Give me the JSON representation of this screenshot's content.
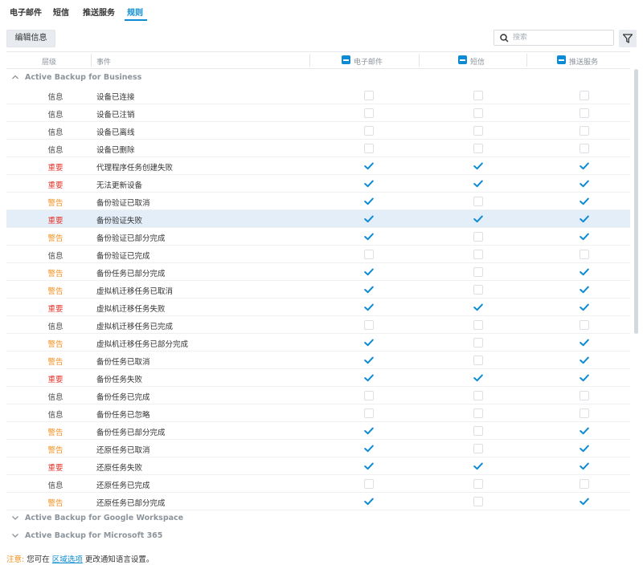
{
  "tabs": [
    {
      "label": "电子邮件",
      "active": false
    },
    {
      "label": "短信",
      "active": false
    },
    {
      "label": "推送服务",
      "active": false
    },
    {
      "label": "规则",
      "active": true
    }
  ],
  "toolbar": {
    "edit_label": "编辑信息",
    "search_placeholder": "搜索"
  },
  "table": {
    "headers": {
      "level": "层级",
      "event": "事件",
      "email": "电子邮件",
      "sms": "短信",
      "push": "推送服务"
    }
  },
  "groups": [
    {
      "label": "Active Backup for Business",
      "expanded": true
    },
    {
      "label": "Active Backup for Google Workspace",
      "expanded": false
    },
    {
      "label": "Active Backup for Microsoft 365",
      "expanded": false
    }
  ],
  "rows": [
    {
      "level": "信息",
      "level_type": "info",
      "event": "设备已连接",
      "email": false,
      "sms": false,
      "push": false
    },
    {
      "level": "信息",
      "level_type": "info",
      "event": "设备已注销",
      "email": false,
      "sms": false,
      "push": false
    },
    {
      "level": "信息",
      "level_type": "info",
      "event": "设备已离线",
      "email": false,
      "sms": false,
      "push": false
    },
    {
      "level": "信息",
      "level_type": "info",
      "event": "设备已删除",
      "email": false,
      "sms": false,
      "push": false
    },
    {
      "level": "重要",
      "level_type": "crit",
      "event": "代理程序任务创建失败",
      "email": true,
      "sms": true,
      "push": true
    },
    {
      "level": "重要",
      "level_type": "crit",
      "event": "无法更新设备",
      "email": true,
      "sms": true,
      "push": true
    },
    {
      "level": "警告",
      "level_type": "warn",
      "event": "备份验证已取消",
      "email": true,
      "sms": false,
      "push": true
    },
    {
      "level": "重要",
      "level_type": "crit",
      "event": "备份验证失败",
      "email": true,
      "sms": true,
      "push": true,
      "highlight": true
    },
    {
      "level": "警告",
      "level_type": "warn",
      "event": "备份验证已部分完成",
      "email": true,
      "sms": false,
      "push": true
    },
    {
      "level": "信息",
      "level_type": "info",
      "event": "备份验证已完成",
      "email": false,
      "sms": false,
      "push": false
    },
    {
      "level": "警告",
      "level_type": "warn",
      "event": "备份任务已部分完成",
      "email": true,
      "sms": false,
      "push": true
    },
    {
      "level": "警告",
      "level_type": "warn",
      "event": "虚拟机迁移任务已取消",
      "email": true,
      "sms": false,
      "push": true
    },
    {
      "level": "重要",
      "level_type": "crit",
      "event": "虚拟机迁移任务失败",
      "email": true,
      "sms": true,
      "push": true
    },
    {
      "level": "信息",
      "level_type": "info",
      "event": "虚拟机迁移任务已完成",
      "email": false,
      "sms": false,
      "push": false
    },
    {
      "level": "警告",
      "level_type": "warn",
      "event": "虚拟机迁移任务已部分完成",
      "email": true,
      "sms": false,
      "push": true
    },
    {
      "level": "警告",
      "level_type": "warn",
      "event": "备份任务已取消",
      "email": true,
      "sms": false,
      "push": true
    },
    {
      "level": "重要",
      "level_type": "crit",
      "event": "备份任务失败",
      "email": true,
      "sms": true,
      "push": true
    },
    {
      "level": "信息",
      "level_type": "info",
      "event": "备份任务已完成",
      "email": false,
      "sms": false,
      "push": false
    },
    {
      "level": "信息",
      "level_type": "info",
      "event": "备份任务已忽略",
      "email": false,
      "sms": false,
      "push": false
    },
    {
      "level": "警告",
      "level_type": "warn",
      "event": "备份任务已部分完成",
      "email": true,
      "sms": false,
      "push": true
    },
    {
      "level": "警告",
      "level_type": "warn",
      "event": "还原任务已取消",
      "email": true,
      "sms": false,
      "push": true
    },
    {
      "level": "重要",
      "level_type": "crit",
      "event": "还原任务失败",
      "email": true,
      "sms": true,
      "push": true
    },
    {
      "level": "信息",
      "level_type": "info",
      "event": "还原任务已完成",
      "email": false,
      "sms": false,
      "push": false
    },
    {
      "level": "警告",
      "level_type": "warn",
      "event": "还原任务已部分完成",
      "email": true,
      "sms": false,
      "push": true
    }
  ],
  "note": {
    "label": "注意:",
    "text_before": "您可在",
    "link": "区域选项",
    "text_after": "更改通知语言设置。"
  },
  "colors": {
    "accent": "#0c8bd4",
    "critical": "#e53b32",
    "warning": "#f08f1c",
    "highlight_row": "#e3eef9"
  }
}
